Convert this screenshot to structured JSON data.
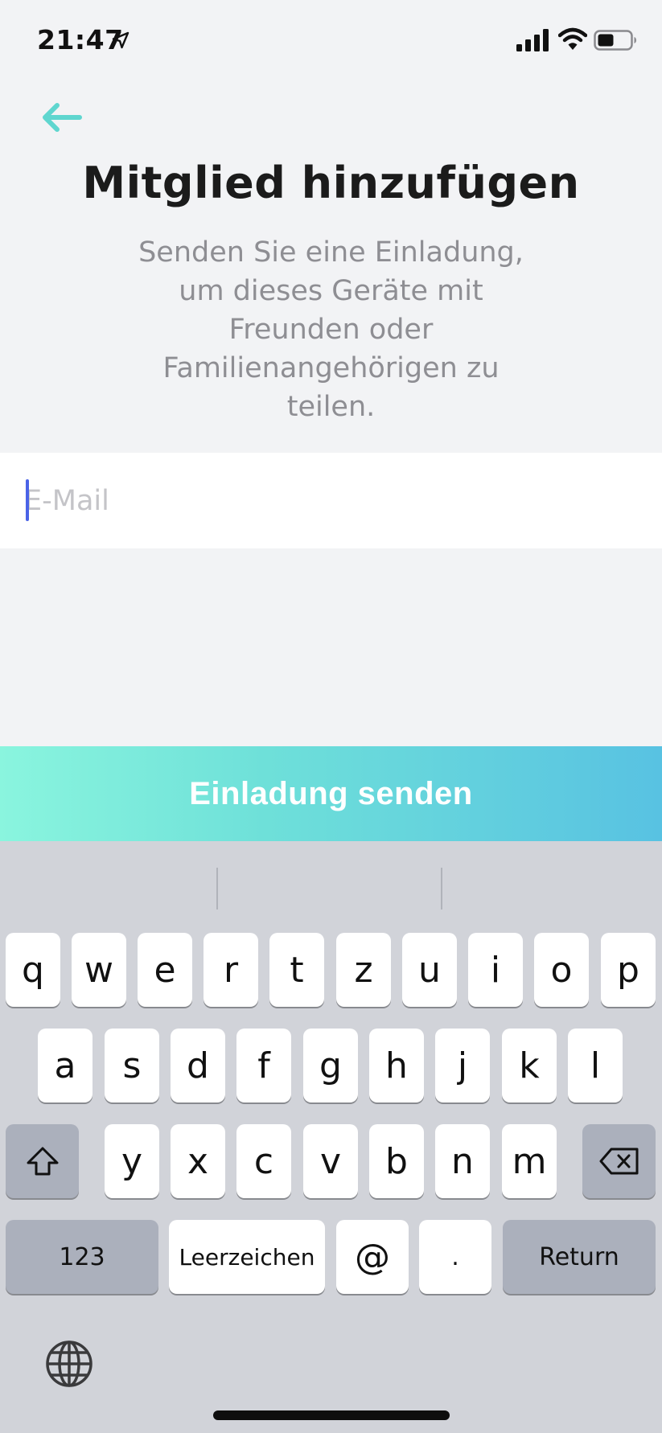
{
  "status": {
    "time": "21:47",
    "icons": [
      "location-arrow-icon",
      "cellular-signal-icon",
      "wifi-icon",
      "battery-icon"
    ]
  },
  "header": {
    "back_icon": "arrow-left-icon",
    "title": "Mitglied hinzufügen",
    "subtitle": "Senden Sie eine Einladung, um dieses Geräte mit Freunden oder Familienangehörigen zu teilen."
  },
  "form": {
    "email_value": "",
    "email_placeholder": "E-Mail"
  },
  "actions": {
    "send_label": "Einladung senden"
  },
  "keyboard": {
    "row1": [
      "q",
      "w",
      "e",
      "r",
      "t",
      "z",
      "u",
      "i",
      "o",
      "p"
    ],
    "row2": [
      "a",
      "s",
      "d",
      "f",
      "g",
      "h",
      "j",
      "k",
      "l"
    ],
    "row3": [
      "y",
      "x",
      "c",
      "v",
      "b",
      "n",
      "m"
    ],
    "numbers_label": "123",
    "space_label": "Leerzeichen",
    "at_label": "@",
    "dot_label": ".",
    "return_label": "Return",
    "shift_icon": "shift-icon",
    "delete_icon": "delete-backspace-icon",
    "globe_icon": "globe-icon"
  },
  "colors": {
    "accent": "#5fd6cf",
    "cursor": "#4a63e7",
    "button_gradient_start": "#8af5de",
    "button_gradient_end": "#58c2e2"
  }
}
